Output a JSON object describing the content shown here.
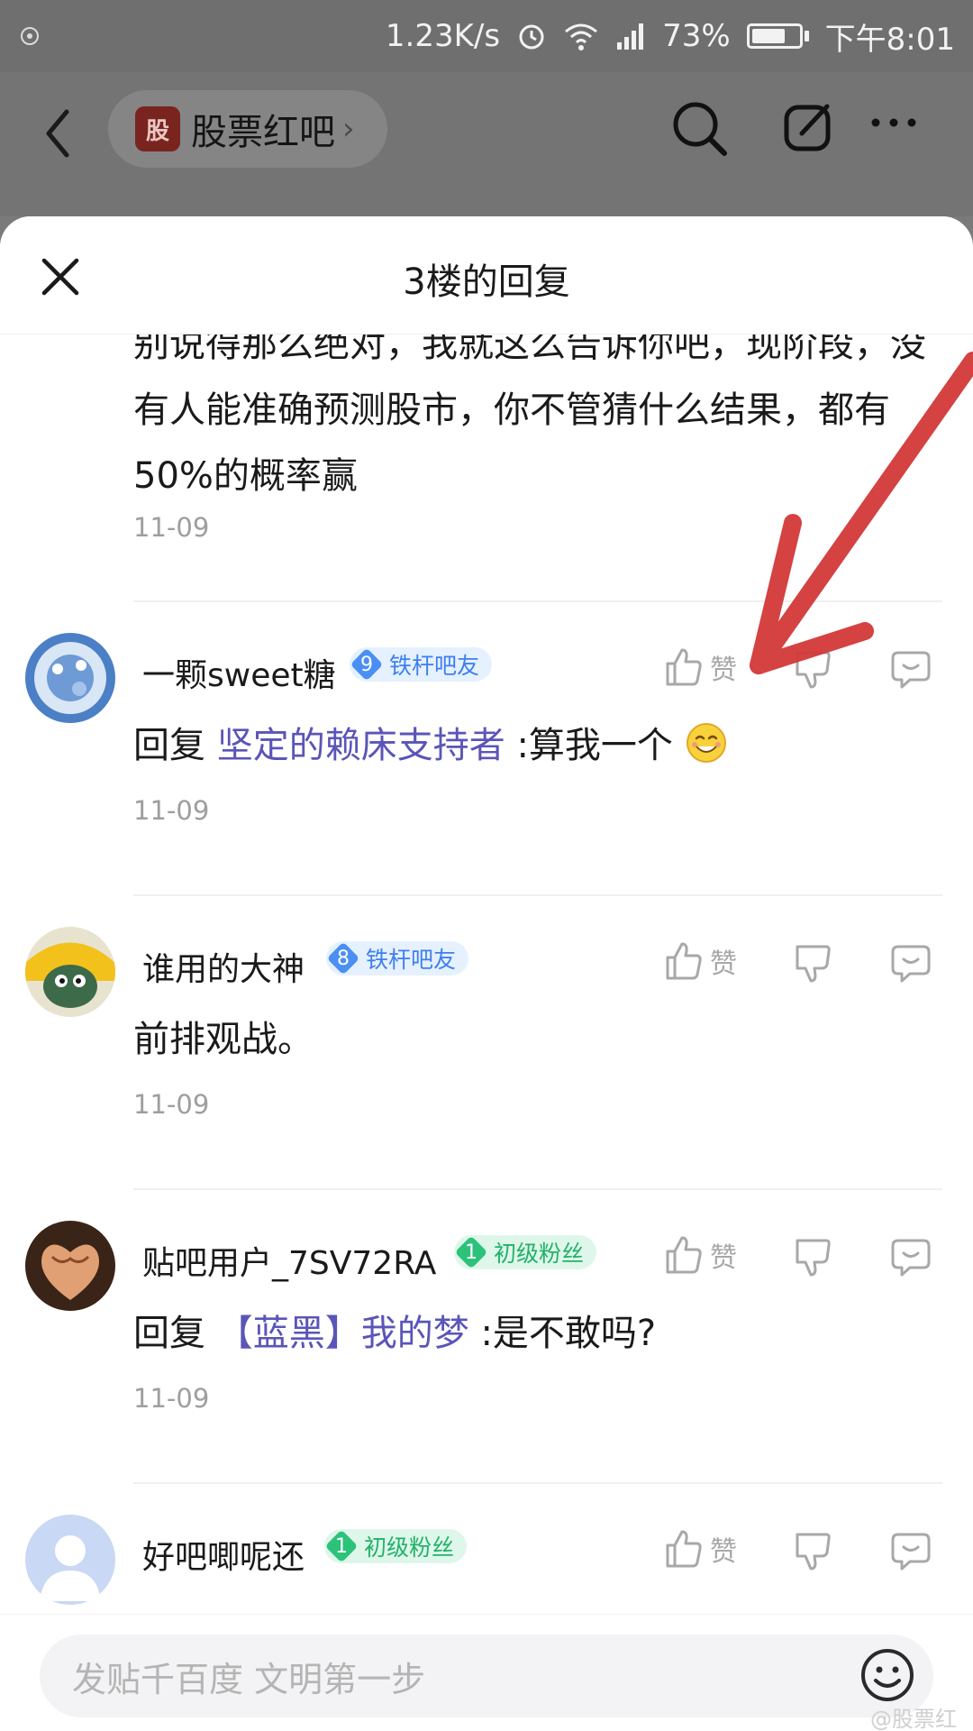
{
  "status_bar": {
    "speed": "1.23K/s",
    "battery": "73%",
    "battery_level": 0.73,
    "time": "下午8:01"
  },
  "header": {
    "forum_name": "股票红吧",
    "forum_avatar_text": "股"
  },
  "sheet": {
    "title": "3楼的回复"
  },
  "first_reply": {
    "text": "别说得那么绝对，我就这么告诉你吧，现阶段，没有人能准确预测股市，你不管猜什么结果，都有50%的概率赢",
    "date": "11-09"
  },
  "replies": [
    {
      "username": "一颗sweet糖",
      "badge_level": "9",
      "badge_label": "铁杆吧友",
      "like_label": "赞",
      "prefix": "回复",
      "mention": "坚定的赖床支持者",
      "text": ":算我一个",
      "emoji": "smile-emoji",
      "date": "11-09"
    },
    {
      "username": "谁用的大神",
      "badge_level": "8",
      "badge_label": "铁杆吧友",
      "like_label": "赞",
      "text": "前排观战。",
      "date": "11-09"
    },
    {
      "username": "贴吧用户_7SV72RA",
      "badge_level": "1",
      "badge_label": "初级粉丝",
      "like_label": "赞",
      "prefix": "回复",
      "mention": "【蓝黑】我的梦",
      "text": ":是不敢吗?",
      "date": "11-09"
    },
    {
      "username": "好吧唧呢还",
      "badge_level": "1",
      "badge_label": "初级粉丝",
      "like_label": "赞"
    }
  ],
  "input": {
    "placeholder": "发贴千百度 文明第一步"
  },
  "watermark": "@股票红",
  "colors": {
    "annotation_arrow": "#d23838",
    "mention": "#5a55b8",
    "badge_blue": "#4b8ff5",
    "badge_green": "#2cc27a"
  }
}
